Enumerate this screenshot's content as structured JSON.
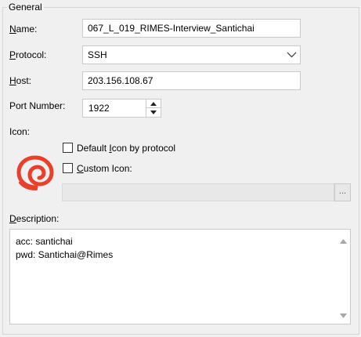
{
  "group": {
    "title": "General"
  },
  "fields": {
    "name": {
      "label_mnemonic": "N",
      "label_rest": "ame:",
      "value": "067_L_019_RIMES-Interview_Santichai"
    },
    "protocol": {
      "label_mnemonic": "P",
      "label_rest": "rotocol:",
      "value": "SSH"
    },
    "host": {
      "label_mnemonic": "H",
      "label_rest": "ost:",
      "value": "203.156.108.67"
    },
    "port": {
      "label_mnemonic": "",
      "label_rest": "Port Number:",
      "value": "1922"
    }
  },
  "icon_section": {
    "label": "Icon:",
    "default_option": {
      "pre": "Default ",
      "mnemonic": "I",
      "post": "con by protocol",
      "checked": false
    },
    "custom_option": {
      "pre": "",
      "mnemonic": "C",
      "post": "ustom Icon:",
      "checked": false
    },
    "custom_path": "",
    "browse_label": "...",
    "protocol_icon": "xshell-spiral-icon",
    "icon_color": "#e8402a"
  },
  "description": {
    "label_mnemonic": "D",
    "label_rest": "escription:",
    "lines": [
      "acc: santichai",
      "pwd: Santichai@Rimes"
    ]
  }
}
